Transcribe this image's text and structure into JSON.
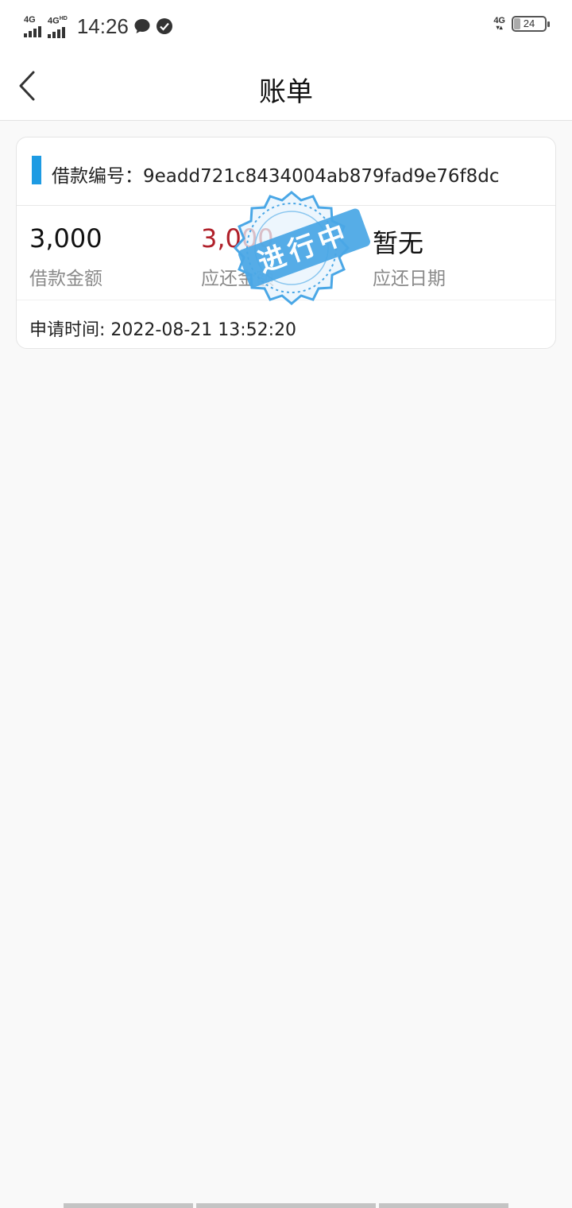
{
  "status_bar": {
    "net1": "4G",
    "net2": "4G",
    "net2_sup": "HD",
    "time": "14:26",
    "net_right": "4G",
    "battery": "24"
  },
  "header": {
    "title": "账单"
  },
  "card": {
    "loan_id_text": "借款编号：9eadd721c8434004ab879fad9e76f8dc",
    "stats": [
      {
        "value": "3,000",
        "label": "借款金额"
      },
      {
        "value": "3,000",
        "label": "应还金额"
      },
      {
        "value": "暂无",
        "label": "应还日期"
      }
    ],
    "apply_time": "申请时间: 2022-08-21 13:52:20",
    "stamp_text": "进行中"
  },
  "colors": {
    "accent": "#1e9be3",
    "amount_due": "#b0202a",
    "stamp": "#4aa7e6"
  }
}
